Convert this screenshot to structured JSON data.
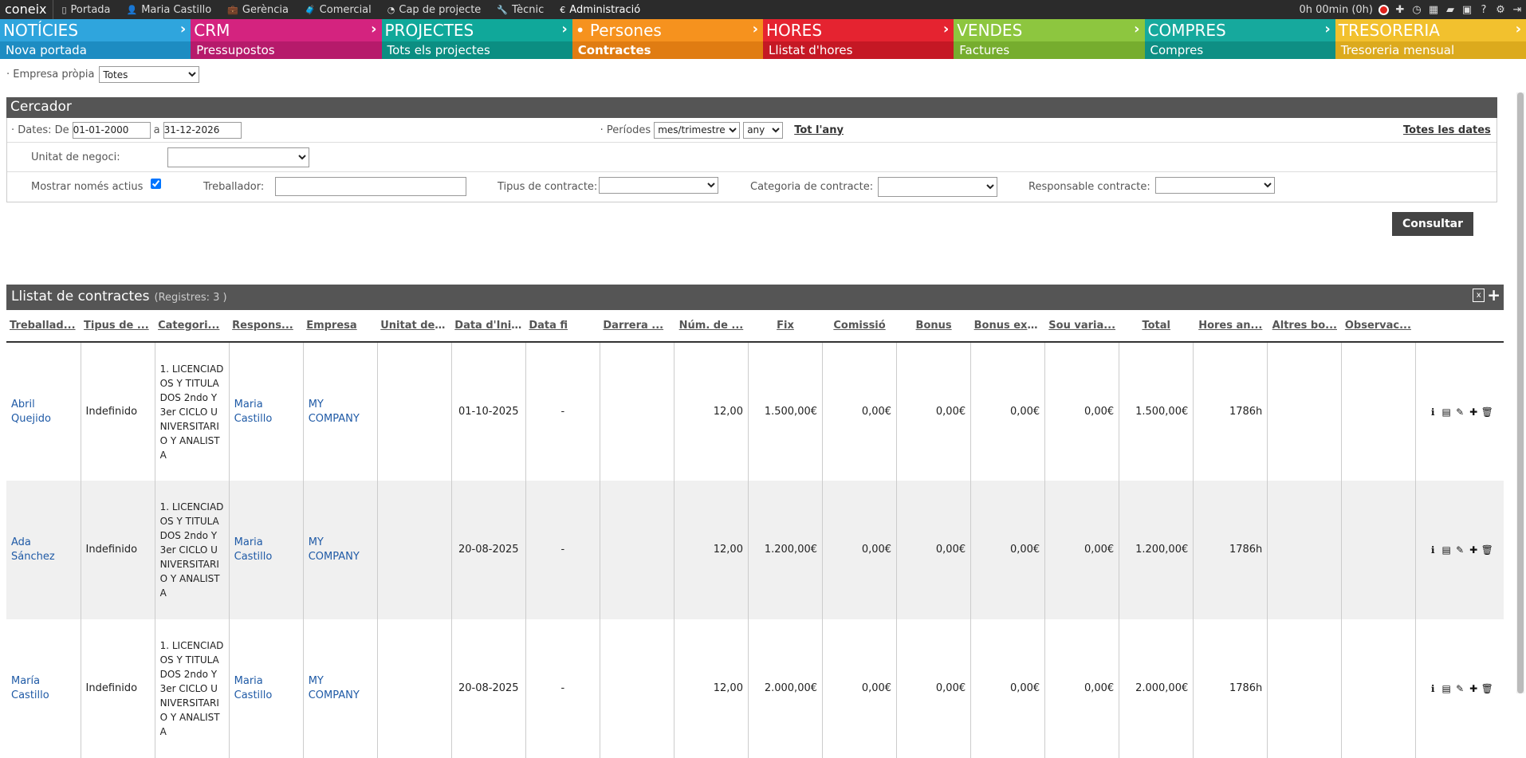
{
  "topbar": {
    "logo": "coneix",
    "nav": [
      {
        "icon": "mobile-icon",
        "glyph": "▯",
        "label": "Portada"
      },
      {
        "icon": "user-icon",
        "glyph": "👤",
        "label": "Maria Castillo"
      },
      {
        "icon": "briefcase-icon",
        "glyph": "💼",
        "label": "Gerència"
      },
      {
        "icon": "suitcase-icon",
        "glyph": "🧳",
        "label": "Comercial"
      },
      {
        "icon": "pie-chart-icon",
        "glyph": "◔",
        "label": "Cap de projecte"
      },
      {
        "icon": "wrench-icon",
        "glyph": "🔧",
        "label": "Tècnic"
      },
      {
        "icon": "euro-icon",
        "glyph": "€",
        "label": "Administració"
      }
    ],
    "timer": "0h 00min (0h)"
  },
  "modules": [
    {
      "title": "NOTÍCIES",
      "sub": "Nova portada",
      "color": "#2fa5dd",
      "subcolor": "#1d8cc2"
    },
    {
      "title": "CRM",
      "sub": "Pressupostos",
      "color": "#d4237f",
      "subcolor": "#b61a6b"
    },
    {
      "title": "PROJECTES",
      "sub": "Tots els projectes",
      "color": "#10a89a",
      "subcolor": "#0b8e82"
    },
    {
      "title": "• Persones",
      "sub": "Contractes",
      "color": "#f6921e",
      "subcolor": "#e07c12"
    },
    {
      "title": "HORES",
      "sub": "Llistat d'hores",
      "color": "#e52330",
      "subcolor": "#c51824"
    },
    {
      "title": "VENDES",
      "sub": "Factures",
      "color": "#8dc63f",
      "subcolor": "#76ad2e"
    },
    {
      "title": "COMPRES",
      "sub": "Compres",
      "color": "#16a99d",
      "subcolor": "#0e8f84"
    },
    {
      "title": "TRESORERIA",
      "sub": "Tresoreria mensual",
      "color": "#f2c12e",
      "subcolor": "#dcaa1d"
    }
  ],
  "empresa": {
    "label": "· Empresa pròpia",
    "value": "Totes"
  },
  "cercador": {
    "title": "Cercador",
    "dates_label": "· Dates: De",
    "date_from": "01-01-2000",
    "a": "a",
    "date_to": "31-12-2026",
    "periodes_label": "· Períodes",
    "periode": "mes/trimestre",
    "any": "any",
    "tot_lany": "Tot l'any",
    "totes_dates": "Totes les dates",
    "unitat_label": "Unitat de negoci:",
    "actius_label": "Mostrar només actius",
    "treballador_label": "Treballador:",
    "tipus_label": "Tipus de contracte:",
    "categoria_label": "Categoria de contracte:",
    "responsable_label": "Responsable contracte:",
    "consultar": "Consultar"
  },
  "list": {
    "title": "Llistat de contractes",
    "registres": "(Registres: 3 )",
    "columns": [
      "Treballad...",
      "Tipus de ...",
      "Categori...",
      "Respons...",
      "Empresa",
      "Unitat de ...",
      "Data d'Ini...",
      "Data fi",
      "Darrera ...",
      "Núm. de ...",
      "Fix",
      "Comissió",
      "Bonus",
      "Bonus ext...",
      "Sou varia...",
      "Total",
      "Hores an...",
      "Altres bo...",
      "Observac...",
      ""
    ],
    "rows": [
      {
        "treballador": "Abril Quejido",
        "tipus": "Indefinido",
        "categoria": "1. LICENCIADOS Y TITULADOS 2ndo Y 3er CICLO UNIVERSITARIO Y ANALISTA",
        "responsable": "Maria Castillo",
        "empresa": "MY COMPANY",
        "unitat": "",
        "inici": "01-10-2025",
        "fi": "-",
        "darrera": "",
        "num": "12,00",
        "fix": "1.500,00€",
        "comissio": "0,00€",
        "bonus": "0,00€",
        "bonusext": "0,00€",
        "souvar": "0,00€",
        "total": "1.500,00€",
        "hores": "1786h",
        "altres": "",
        "obs": ""
      },
      {
        "treballador": "Ada Sánchez",
        "tipus": "Indefinido",
        "categoria": "1. LICENCIADOS Y TITULADOS 2ndo Y 3er CICLO UNIVERSITARIO Y ANALISTA",
        "responsable": "Maria Castillo",
        "empresa": "MY COMPANY",
        "unitat": "",
        "inici": "20-08-2025",
        "fi": "-",
        "darrera": "",
        "num": "12,00",
        "fix": "1.200,00€",
        "comissio": "0,00€",
        "bonus": "0,00€",
        "bonusext": "0,00€",
        "souvar": "0,00€",
        "total": "1.200,00€",
        "hores": "1786h",
        "altres": "",
        "obs": ""
      },
      {
        "treballador": "María Castillo",
        "tipus": "Indefinido",
        "categoria": "1. LICENCIADOS Y TITULADOS 2ndo Y 3er CICLO UNIVERSITARIO Y ANALISTA",
        "responsable": "Maria Castillo",
        "empresa": "MY COMPANY",
        "unitat": "",
        "inici": "20-08-2025",
        "fi": "-",
        "darrera": "",
        "num": "12,00",
        "fix": "2.000,00€",
        "comissio": "0,00€",
        "bonus": "0,00€",
        "bonusext": "0,00€",
        "souvar": "0,00€",
        "total": "2.000,00€",
        "hores": "1786h",
        "altres": "",
        "obs": ""
      }
    ]
  }
}
